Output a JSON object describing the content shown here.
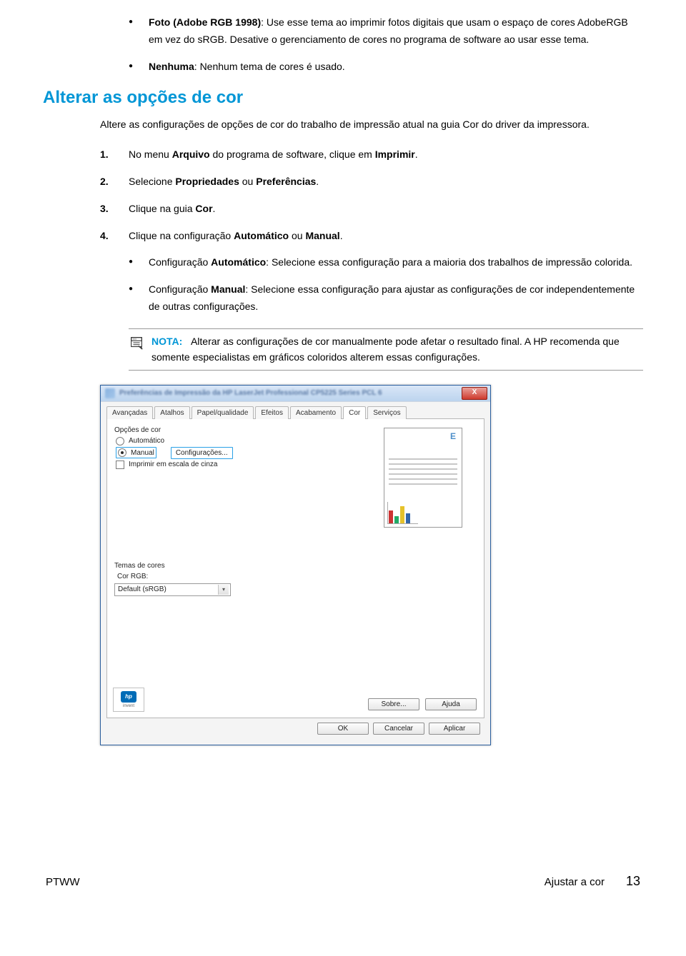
{
  "bullets_top": [
    {
      "bold": "Foto (Adobe RGB 1998)",
      "text": ": Use esse tema ao imprimir fotos digitais que usam o espaço de cores AdobeRGB em vez do sRGB. Desative o gerenciamento de cores no programa de software ao usar esse tema."
    },
    {
      "bold": "Nenhuma",
      "text": ": Nenhum tema de cores é usado."
    }
  ],
  "section_heading": "Alterar as opções de cor",
  "intro_para": "Altere as configurações de opções de cor do trabalho de impressão atual na guia Cor do driver da impressora.",
  "steps": [
    {
      "num": "1.",
      "pre": "No menu ",
      "b1": "Arquivo",
      "mid": " do programa de software, clique em ",
      "b2": "Imprimir",
      "post": "."
    },
    {
      "num": "2.",
      "pre": "Selecione ",
      "b1": "Propriedades",
      "mid": " ou ",
      "b2": "Preferências",
      "post": "."
    },
    {
      "num": "3.",
      "pre": "Clique na guia ",
      "b1": "Cor",
      "mid": "",
      "b2": "",
      "post": "."
    },
    {
      "num": "4.",
      "pre": "Clique na configuração ",
      "b1": "Automático",
      "mid": " ou ",
      "b2": "Manual",
      "post": "."
    }
  ],
  "sub_bullets": [
    {
      "pre": "Configuração ",
      "bold": "Automático",
      "post": ": Selecione essa configuração para a maioria dos trabalhos de impressão colorida."
    },
    {
      "pre": "Configuração ",
      "bold": "Manual",
      "post": ": Selecione essa configuração para ajustar as configurações de cor independentemente de outras configurações."
    }
  ],
  "note": {
    "label": "NOTA:",
    "text": "Alterar as configurações de cor manualmente pode afetar o resultado final. A HP recomenda que somente especialistas em gráficos coloridos alterem essas configurações."
  },
  "dialog": {
    "title_blur": "Preferências de Impressão da HP LaserJet Professional CP5225 Series PCL 6",
    "close": "X",
    "tabs": [
      "Avançadas",
      "Atalhos",
      "Papel/qualidade",
      "Efeitos",
      "Acabamento",
      "Cor",
      "Serviços"
    ],
    "active_tab_index": 5,
    "group1_title": "Opções de cor",
    "radio_auto": "Automático",
    "radio_manual": "Manual",
    "config_btn": "Configurações...",
    "check_gray": "Imprimir em escala de cinza",
    "group2_title": "Temas de cores",
    "group2_label": "Cor RGB:",
    "select_value": "Default (sRGB)",
    "preview_letter": "E",
    "hp_text": "invent",
    "about_btn": "Sobre...",
    "help_btn": "Ajuda",
    "ok_btn": "OK",
    "cancel_btn": "Cancelar",
    "apply_btn": "Aplicar"
  },
  "footer": {
    "left": "PTWW",
    "section": "Ajustar a cor",
    "page": "13"
  }
}
